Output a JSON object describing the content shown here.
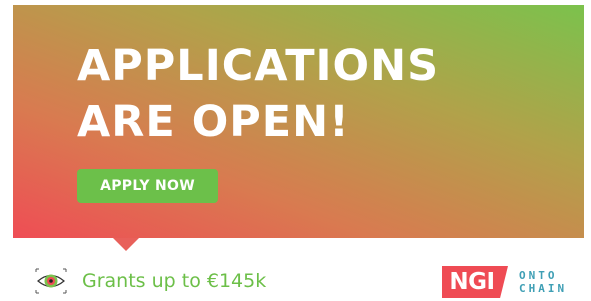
{
  "hero": {
    "headline_line1": "APPLICATIONS",
    "headline_line2": "ARE OPEN!",
    "apply_label": "APPLY NOW"
  },
  "footer": {
    "icon": "eye-icon",
    "grants_text": "Grants up to €145k",
    "logo_ngi": "NGI",
    "logo_onto": "ONTO",
    "logo_chain": "CHAIN"
  },
  "colors": {
    "gradient_green": "#7bc24c",
    "gradient_red": "#ef4d55",
    "accent_green": "#6cc04a",
    "ngi_red": "#ef4b54",
    "onto_chain_teal": "#3f9fb5"
  }
}
